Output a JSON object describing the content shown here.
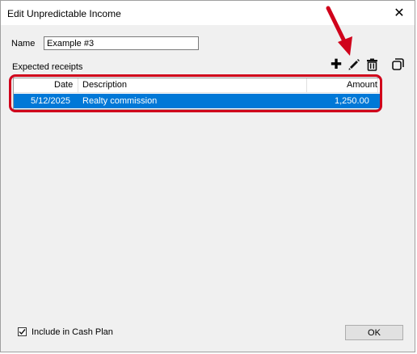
{
  "window": {
    "title": "Edit Unpredictable Income",
    "close_glyph": "✕"
  },
  "form": {
    "name_label": "Name",
    "name_value": "Example #3",
    "section_label": "Expected receipts"
  },
  "toolbar": {
    "icons": [
      "add-icon",
      "edit-pencil-icon",
      "delete-trash-icon",
      "copy-icon"
    ],
    "add_glyph": "✚"
  },
  "grid": {
    "columns": [
      "Date",
      "Description",
      "Amount"
    ],
    "rows": [
      {
        "date": "5/12/2025",
        "description": "Realty commission",
        "amount": "1,250.00"
      }
    ],
    "selected_color": "#0078d7"
  },
  "footer": {
    "include_label": "Include in Cash Plan",
    "include_checked": true,
    "ok_label": "OK"
  },
  "annotation": {
    "color": "#d0021b"
  }
}
